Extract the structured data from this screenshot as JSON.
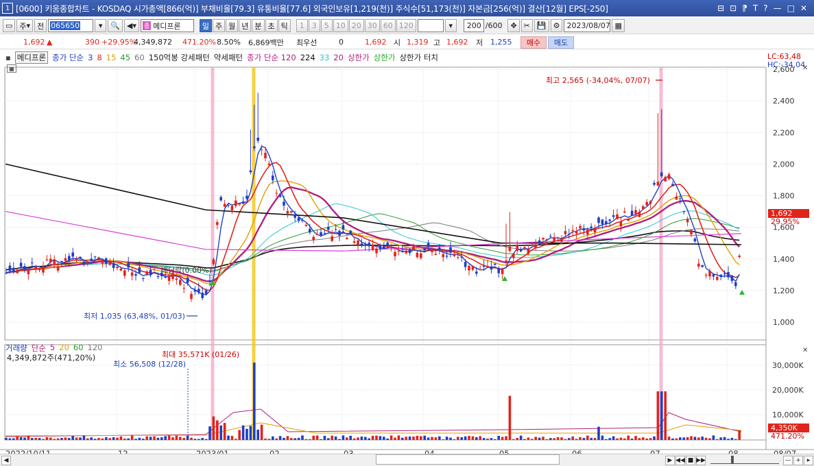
{
  "window": {
    "number": "1",
    "title": "[0600] 키움종합차트 - KOSDAQ 시가총액[866(억)] 부채비율[79.3] 유통비율[77.6] 외국인보유[1,219(천)] 주식수[51,173(천)] 자본금[256(억)] 결산[12월] EPS[-250]",
    "icons": [
      "⊟",
      "⊡",
      "⁋",
      "T",
      "?",
      "—",
      "□",
      "✕"
    ]
  },
  "toolbar": {
    "market_label": "주",
    "prev_label": "전",
    "code": "065650",
    "stock_tag": "종",
    "stock_name": "메디프론",
    "periods": [
      "일",
      "주",
      "월",
      "년",
      "분",
      "초",
      "틱"
    ],
    "selected_period": "일",
    "intervals": [
      "1",
      "3",
      "5",
      "10",
      "20",
      "30",
      "60",
      "120"
    ],
    "count": "200",
    "count_total": "/600",
    "date": "2023/08/07"
  },
  "price": {
    "current": "1,692",
    "change": "390",
    "change_pct": "+29.95%",
    "volume": "4,349,872",
    "volume_pct": "471.20%",
    "turnover": "8.50%",
    "trade_value": "6,869백만",
    "pref_label": "최우선",
    "pref_value": "0",
    "ask": "1,692",
    "open_label": "시",
    "open": "1,319",
    "high_label": "고",
    "high": "1,692",
    "low_label": "저",
    "low": "1,255",
    "buy_label": "매수",
    "sell_label": "매도"
  },
  "legend": {
    "stock": "메디프론",
    "ma_label": "종가 단순",
    "ma_periods": [
      {
        "v": "3",
        "c": "#1e3fc4"
      },
      {
        "v": "8",
        "c": "#e1241b"
      },
      {
        "v": "15",
        "c": "#e0a000"
      },
      {
        "v": "45",
        "c": "#2f9a2f"
      },
      {
        "v": "60",
        "c": "#777777"
      }
    ],
    "pattern_label": "150억봉 강세패턴",
    "weak_label": "약세패턴",
    "ma2_label": "종가 단순 120",
    "ma2_periods": [
      {
        "v": "224",
        "c": "#111111"
      },
      {
        "v": "33",
        "c": "#2fc4d6"
      },
      {
        "v": "20",
        "c": "#b0207f"
      }
    ],
    "limit_up": "상한가",
    "limit_up2": "상한가",
    "limit_touch": "상한가 터치"
  },
  "chart_data": {
    "type": "candlestick",
    "y_ticks": [
      "2,600",
      "2,400",
      "2,200",
      "2,000",
      "1,800",
      "1,600",
      "1,400",
      "1,200",
      "1,000"
    ],
    "x_ticks": [
      "2022/10/11",
      "12",
      "2023/01",
      "02",
      "03",
      "04",
      "05",
      "06",
      "07",
      "08",
      "08/07"
    ],
    "annotations": {
      "high": "최고 2,565 (-34,04%, 07/07)",
      "low": "최저 1,035 (63,48%, 01/03)",
      "trend": "배당락(0.00%)"
    },
    "lc": "LC:63,48",
    "hc": "HC:-34,04",
    "last_price": "1,692",
    "last_pct": "29.95%"
  },
  "volume": {
    "legend_label": "거래량",
    "ma_label": "단순",
    "ma_periods": [
      {
        "v": "5",
        "c": "#b0207f"
      },
      {
        "v": "20",
        "c": "#e0a000"
      },
      {
        "v": "60",
        "c": "#2f9a2f"
      },
      {
        "v": "120",
        "c": "#777777"
      }
    ],
    "info": "4,349,872주(471,20%)",
    "max_annot": "최대 35,571K (01/26)",
    "min_annot": "최소 56,508 (12/28)",
    "y_ticks": [
      "30,000K",
      "20,000K",
      "10,000K"
    ],
    "last": "4,350K",
    "last_pct": "471.20%"
  }
}
